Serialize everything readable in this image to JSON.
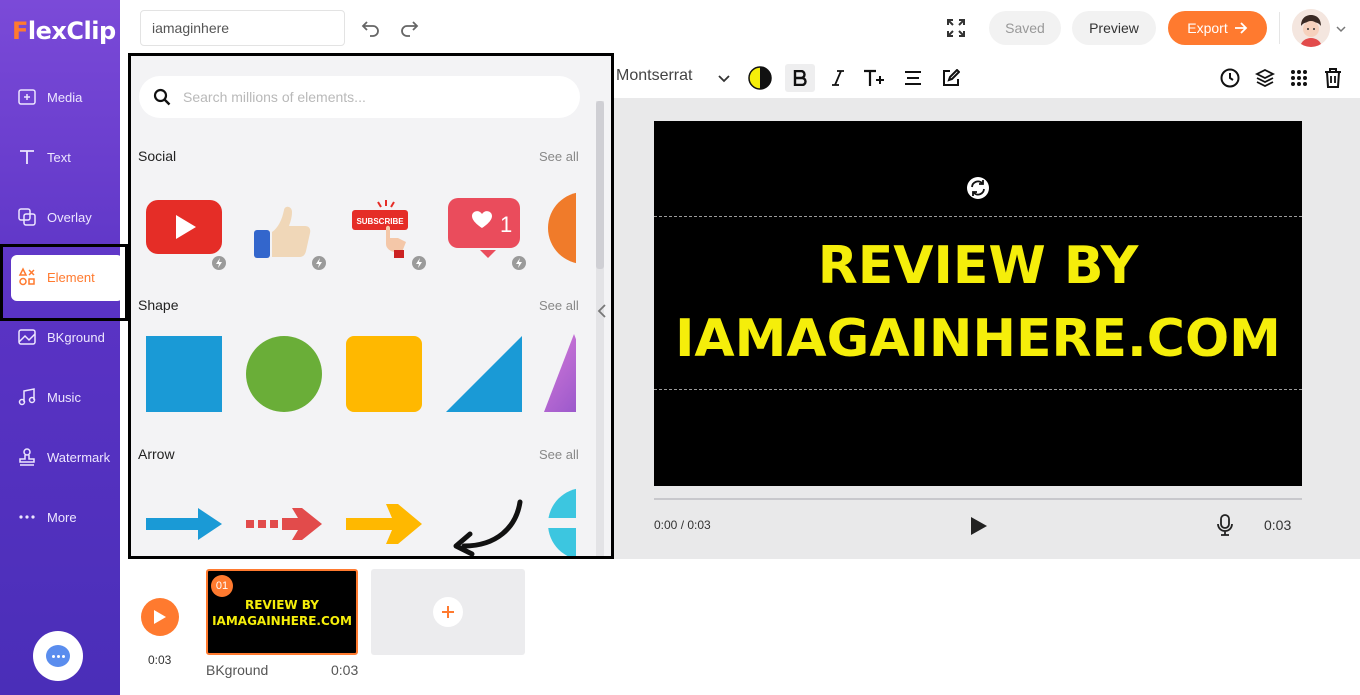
{
  "app": {
    "logo": "FlexClip",
    "logo_initial": "F",
    "logo_rest": "lexClip"
  },
  "sidebar": {
    "items": [
      {
        "label": "Media",
        "icon": "media-add-icon"
      },
      {
        "label": "Text",
        "icon": "text-t-icon"
      },
      {
        "label": "Overlay",
        "icon": "overlay-icon"
      },
      {
        "label": "Element",
        "icon": "element-shapes-icon",
        "active": true
      },
      {
        "label": "BKground",
        "icon": "background-icon"
      },
      {
        "label": "Music",
        "icon": "music-note-icon"
      },
      {
        "label": "Watermark",
        "icon": "watermark-stamp-icon"
      },
      {
        "label": "More",
        "icon": "more-dots-icon"
      }
    ]
  },
  "topbar": {
    "project_name": "iamaginhere",
    "saved_label": "Saved",
    "preview_label": "Preview",
    "export_label": "Export"
  },
  "panel": {
    "search_placeholder": "Search millions of elements...",
    "sections": [
      {
        "title": "Social",
        "see_all": "See all"
      },
      {
        "title": "Shape",
        "see_all": "See all"
      },
      {
        "title": "Arrow",
        "see_all": "See all"
      }
    ],
    "subscribe_text": "SUBSCRIBE",
    "like_count": "1"
  },
  "toolbar": {
    "font": "Montserrat"
  },
  "stage": {
    "line1": "REVIEW BY",
    "line2": "IAMAGAINHERE.COM",
    "time_current": "0:00 / 0:03",
    "time_total": "0:03"
  },
  "timeline": {
    "time": "0:03",
    "clip_number": "01",
    "clip_line1": "REVIEW BY",
    "clip_line2": "IAMAGAINHERE.COM",
    "clip_label": "BKground",
    "clip_duration": "0:03"
  },
  "colors": {
    "accent": "#ff7a2f",
    "sidebar": "#5a33c4",
    "stage_text": "#f5ee0a"
  }
}
